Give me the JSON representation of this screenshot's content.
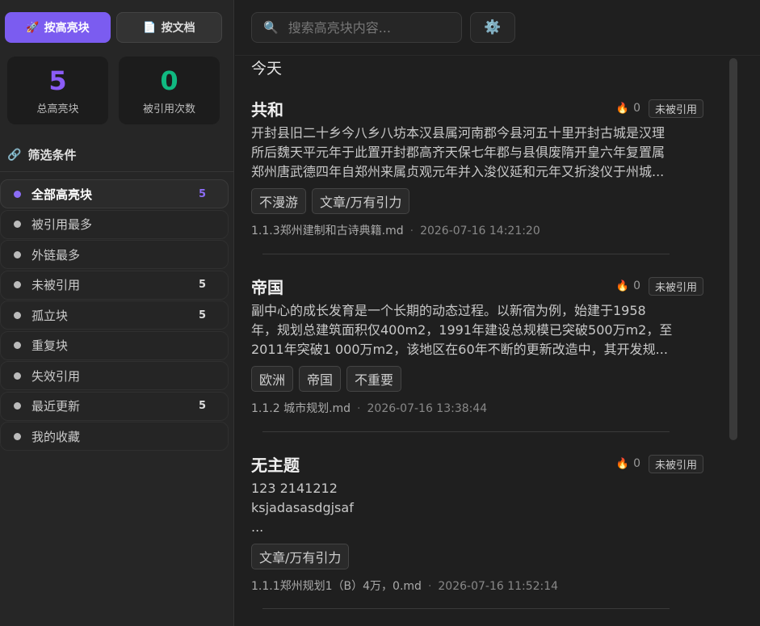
{
  "modes": {
    "by_block": {
      "icon": "rocket-icon",
      "label": "按高亮块"
    },
    "by_doc": {
      "icon": "document-icon",
      "label": "按文档"
    }
  },
  "stats": [
    {
      "value": "5",
      "label": "总高亮块",
      "color": "#8b5cf6"
    },
    {
      "value": "0",
      "label": "被引用次数",
      "color": "#10b981"
    }
  ],
  "filter": {
    "title": "筛选条件",
    "icon": "link-icon",
    "items": [
      {
        "label": "全部高亮块",
        "count": "5",
        "active": true
      },
      {
        "label": "被引用最多",
        "count": ""
      },
      {
        "label": "外链最多",
        "count": ""
      },
      {
        "label": "未被引用",
        "count": "5"
      },
      {
        "label": "孤立块",
        "count": "5"
      },
      {
        "label": "重复块",
        "count": ""
      },
      {
        "label": "失效引用",
        "count": ""
      },
      {
        "label": "最近更新",
        "count": "5"
      },
      {
        "label": "我的收藏",
        "count": ""
      }
    ]
  },
  "search": {
    "placeholder": "搜索高亮块内容...",
    "icon": "search-icon"
  },
  "settings": {
    "icon": "gear-icon"
  },
  "day_label": "今天",
  "cards": [
    {
      "title": "共和",
      "fire": "🔥",
      "ref_count": "0",
      "badge": "未被引用",
      "body": [
        "开封县旧二十乡今八乡八坊本汉县属河南郡今县河五十里开封古城是汉理",
        "所后魏天平元年于此置开封郡高齐天保七年郡与县俱废隋开皇六年复置属",
        "郑州唐武德四年自郑州来属贞观元年并入浚仪延和元年又折浚仪于州城..."
      ],
      "tags": [
        "不漫游",
        "文章/万有引力"
      ],
      "file": "1.1.3郑州建制和古诗典籍.md",
      "time": "2026-07-16 14:21:20"
    },
    {
      "title": "帝国",
      "fire": "🔥",
      "ref_count": "0",
      "badge": "未被引用",
      "body": [
        "副中心的成长发育是一个长期的动态过程。以新宿为例，始建于1958",
        "年，规划总建筑面积仅400m2，1991年建设总规模已突破500万m2，至",
        "2011年突破1 000万m2，该地区在60年不断的更新改造中，其开发规..."
      ],
      "tags": [
        "欧洲",
        "帝国",
        "不重要"
      ],
      "file": "1.1.2 城市规划.md",
      "time": "2026-07-16 13:38:44"
    },
    {
      "title": "无主题",
      "fire": "🔥",
      "ref_count": "0",
      "badge": "未被引用",
      "body": [
        "123 2141212",
        "ksjadasasdgjsaf",
        "..."
      ],
      "tags": [
        "文章/万有引力"
      ],
      "file": "1.1.1郑州规划1（B）4万，0.md",
      "time": "2026-07-16 11:52:14"
    }
  ]
}
